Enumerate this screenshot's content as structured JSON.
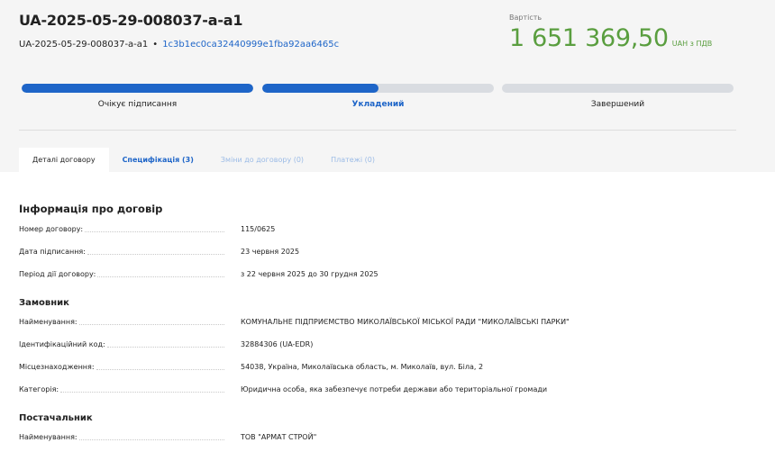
{
  "header": {
    "title": "UA-2025-05-29-008037-a-a1",
    "sub_id": "UA-2025-05-29-008037-a-a1",
    "separator": "•",
    "hash": "1c3b1ec0ca32440999e1fba92aa6465c",
    "price_label": "Вартість",
    "price_amount": "1 651 369,50",
    "price_currency": "UAH з ПДВ"
  },
  "progress": {
    "steps": [
      {
        "label": "Очікує підписання",
        "progress": 1.0,
        "active": false
      },
      {
        "label": "Укладений",
        "progress": 0.5,
        "active": true
      },
      {
        "label": "Завершений",
        "progress": 0.0,
        "active": false
      }
    ]
  },
  "tabs": [
    {
      "label": "Деталі договору",
      "state": "active"
    },
    {
      "label": "Специфікація (3)",
      "state": "link"
    },
    {
      "label": "Зміни до договору (0)",
      "state": "disabled"
    },
    {
      "label": "Платежі (0)",
      "state": "disabled"
    }
  ],
  "contract_info": {
    "heading": "Інформація про договір",
    "rows": [
      {
        "label": "Номер договору:",
        "value": "115/0625"
      },
      {
        "label": "Дата підписання:",
        "value": "23 червня 2025"
      },
      {
        "label": "Період дії договору:",
        "value": "з 22 червня 2025 до 30 грудня 2025"
      }
    ]
  },
  "customer": {
    "heading": "Замовник",
    "rows": [
      {
        "label": "Найменування:",
        "value": "КОМУНАЛЬНЕ ПІДПРИЄМСТВО МИКОЛАЇВСЬКОЇ МІСЬКОЇ РАДИ \"МИКОЛАЇВСЬКІ ПАРКИ\""
      },
      {
        "label": "Ідентифікаційний код:",
        "value": "32884306 (UA-EDR)"
      },
      {
        "label": "Місцезнаходження:",
        "value": "54038, Україна, Миколаївська область, м. Миколаїв, вул. Біла, 2"
      },
      {
        "label": "Категорія:",
        "value": "Юридична особа, яка забезпечує потреби держави або територіальної громади"
      }
    ]
  },
  "supplier": {
    "heading": "Постачальник",
    "rows": [
      {
        "label": "Найменування:",
        "value": "ТОВ \"АРМАТ СТРОЙ\""
      }
    ]
  },
  "colors": {
    "accent": "#1e65c8",
    "price_green": "#5a9e3f",
    "bar_track": "#d9dce1",
    "header_bg": "#f5f5f5"
  }
}
